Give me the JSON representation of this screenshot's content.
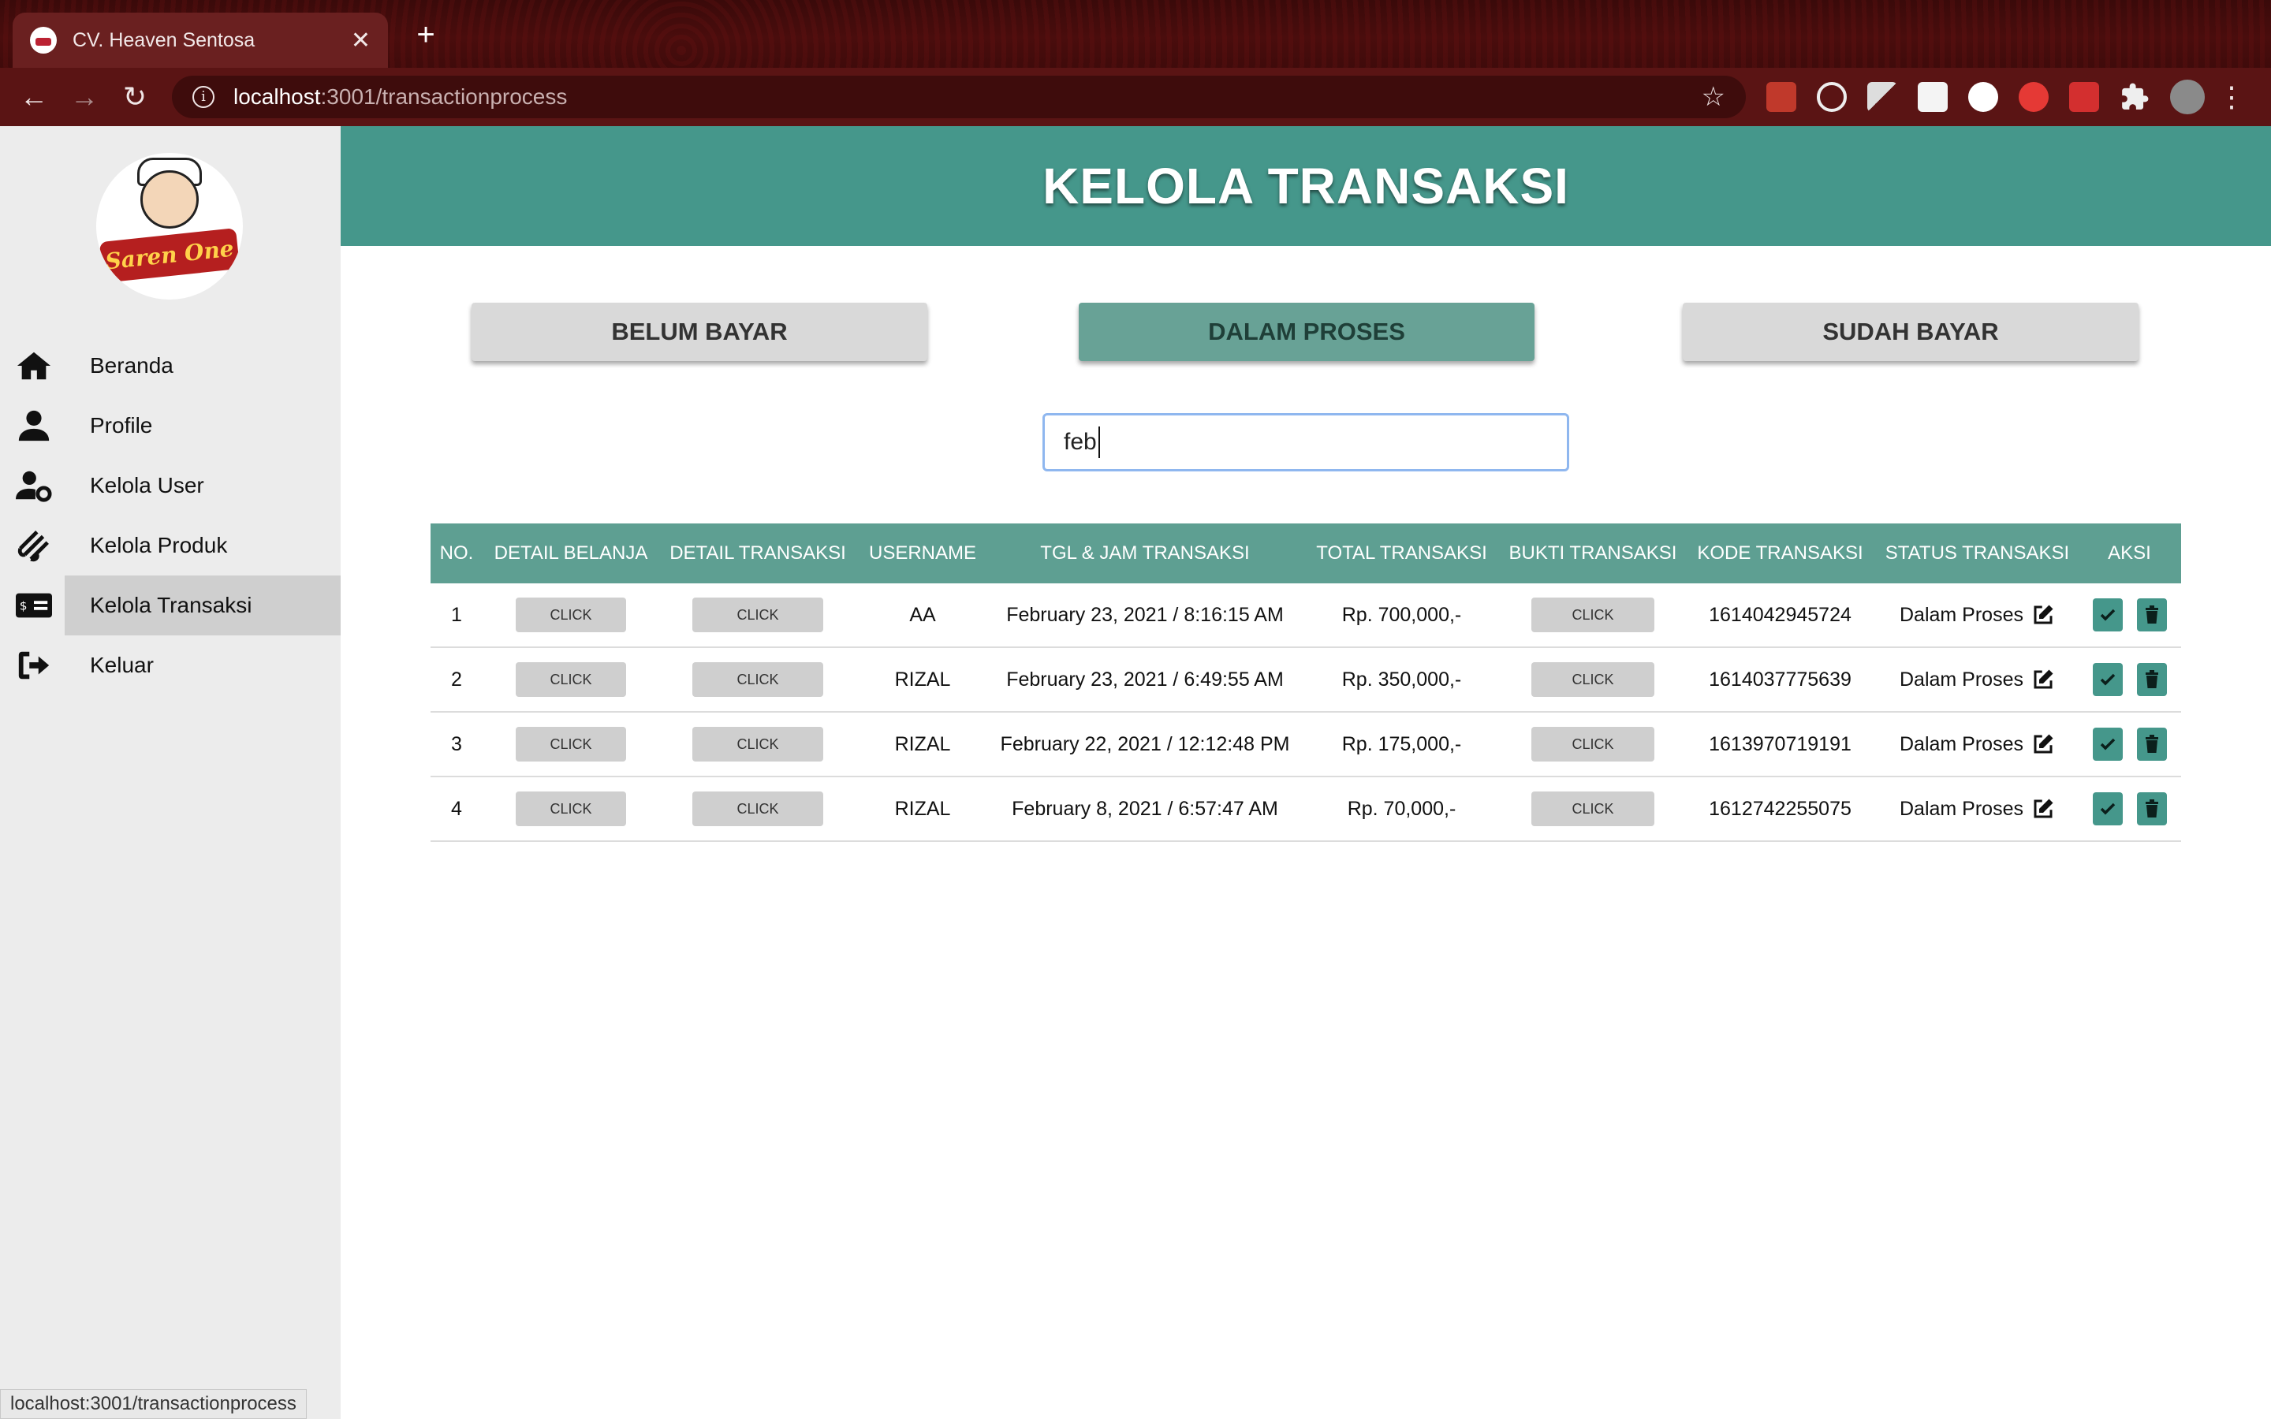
{
  "browser": {
    "tab_title": "CV. Heaven Sentosa",
    "tab_close": "✕",
    "new_tab": "+",
    "url_host": "localhost",
    "url_rest": ":3001/transactionprocess",
    "status_url": "localhost:3001/transactionprocess"
  },
  "sidebar": {
    "logo_text": "Saren One",
    "items": [
      {
        "label": "Beranda",
        "icon": "home-icon"
      },
      {
        "label": "Profile",
        "icon": "user-icon"
      },
      {
        "label": "Kelola User",
        "icon": "user-gear-icon"
      },
      {
        "label": "Kelola Produk",
        "icon": "product-icon"
      },
      {
        "label": "Kelola Transaksi",
        "icon": "money-check-icon",
        "active": true
      },
      {
        "label": "Keluar",
        "icon": "sign-out-icon"
      }
    ]
  },
  "header": {
    "title": "KELOLA TRANSAKSI"
  },
  "filters": {
    "unpaid": "BELUM BAYAR",
    "processing": "DALAM PROSES",
    "paid": "SUDAH BAYAR",
    "active": "processing"
  },
  "search": {
    "value": "feb"
  },
  "table": {
    "headers": [
      "NO.",
      "DETAIL BELANJA",
      "DETAIL TRANSAKSI",
      "USERNAME",
      "TGL & JAM TRANSAKSI",
      "TOTAL TRANSAKSI",
      "BUKTI TRANSAKSI",
      "KODE TRANSAKSI",
      "STATUS TRANSAKSI",
      "AKSI"
    ],
    "click_label": "CLICK",
    "rows": [
      {
        "no": "1",
        "username": "AA",
        "datetime": "February 23, 2021 / 8:16:15 AM",
        "total": "Rp. 700,000,-",
        "code": "1614042945724",
        "status": "Dalam Proses"
      },
      {
        "no": "2",
        "username": "RIZAL",
        "datetime": "February 23, 2021 / 6:49:55 AM",
        "total": "Rp. 350,000,-",
        "code": "1614037775639",
        "status": "Dalam Proses"
      },
      {
        "no": "3",
        "username": "RIZAL",
        "datetime": "February 22, 2021 / 12:12:48 PM",
        "total": "Rp. 175,000,-",
        "code": "1613970719191",
        "status": "Dalam Proses"
      },
      {
        "no": "4",
        "username": "RIZAL",
        "datetime": "February 8, 2021 / 6:57:47 AM",
        "total": "Rp. 70,000,-",
        "code": "1612742255075",
        "status": "Dalam Proses"
      }
    ]
  },
  "colors": {
    "header": "#45978b",
    "table_header": "#5e9f92",
    "active_filter": "#68a296",
    "sidebar": "#ececec"
  }
}
